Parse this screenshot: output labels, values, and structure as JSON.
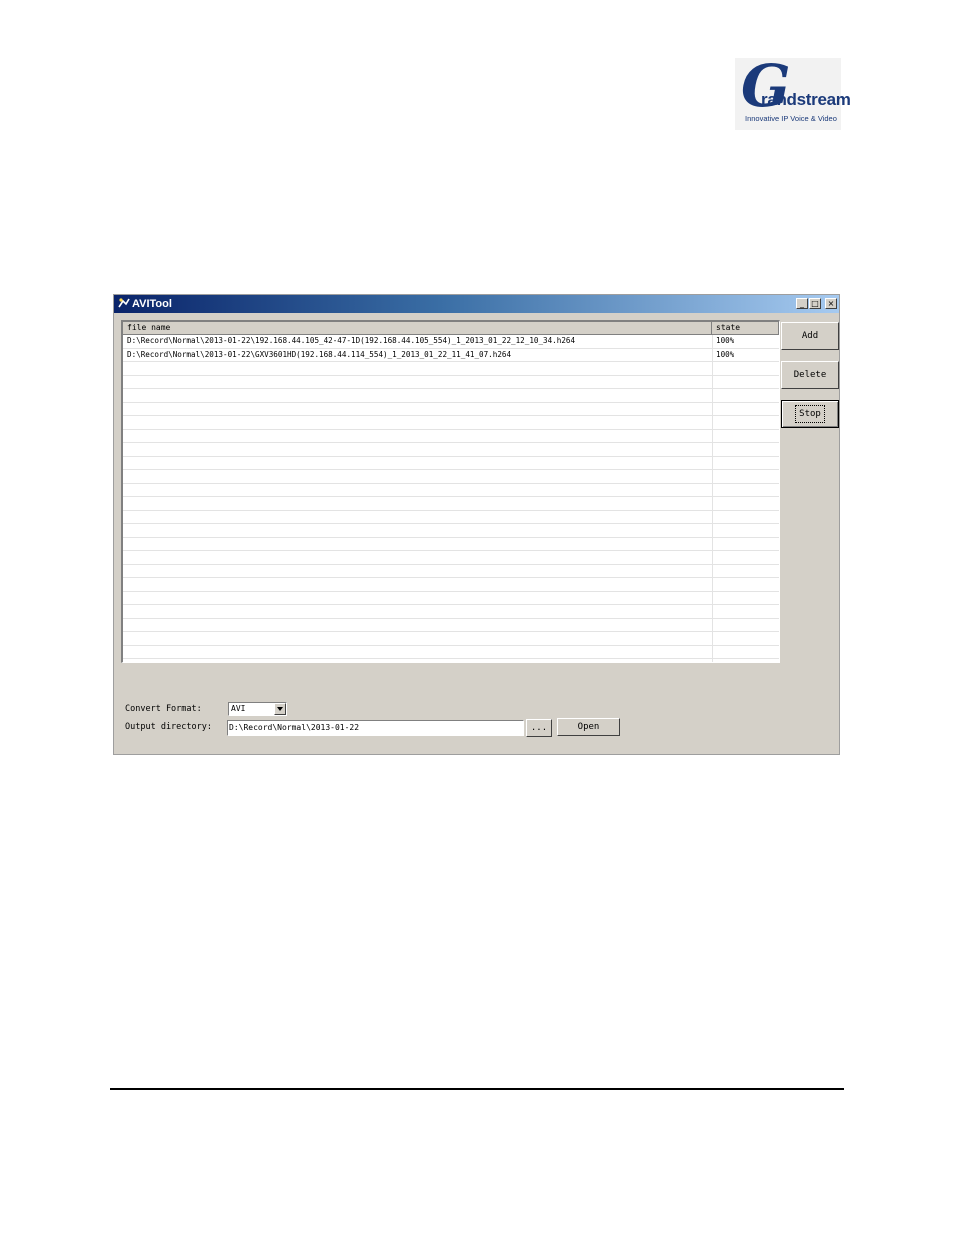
{
  "logo": {
    "letter": "G",
    "word": "randstream",
    "tagline": "Innovative IP Voice & Video"
  },
  "window": {
    "title": "AVITool",
    "minimize_glyph": "_",
    "maximize_glyph": "□",
    "close_glyph": "×"
  },
  "list": {
    "columns": [
      "file name",
      "state"
    ],
    "rows": [
      {
        "file": "D:\\Record\\Normal\\2013-01-22\\192.168.44.105_42-47-1D(192.168.44.105_554)_1_2013_01_22_12_10_34.h264",
        "state": "100%"
      },
      {
        "file": "D:\\Record\\Normal\\2013-01-22\\GXV3601HD(192.168.44.114_554)_1_2013_01_22_11_41_07.h264",
        "state": "100%"
      }
    ]
  },
  "buttons": {
    "add": "Add",
    "delete": "Delete",
    "stop": "Stop",
    "browse": "...",
    "open": "Open"
  },
  "form": {
    "convert_format_label": "Convert Format:",
    "convert_format_value": "AVI",
    "output_directory_label": "Output directory:",
    "output_directory_value": "D:\\Record\\Normal\\2013-01-22"
  }
}
